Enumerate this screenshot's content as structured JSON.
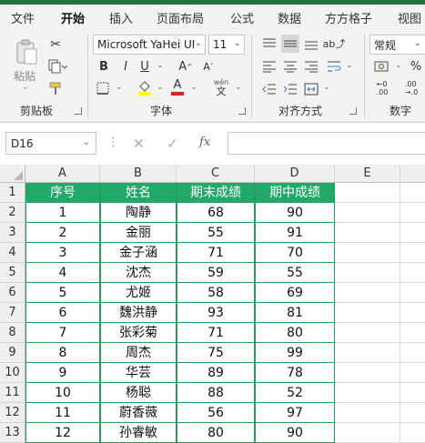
{
  "colors": {
    "accent": "#217346",
    "header_fill": "#22a868",
    "header_text": "#ffffff"
  },
  "tabs": [
    "文件",
    "开始",
    "插入",
    "页面布局",
    "公式",
    "数据",
    "方方格子",
    "视图"
  ],
  "active_tab": "开始",
  "ribbon": {
    "clipboard": {
      "paste_label": "粘贴",
      "group_label": "剪贴板"
    },
    "font": {
      "font_name": "Microsoft YaHei UI",
      "font_size": "11",
      "group_label": "字体",
      "bold": "B",
      "italic": "I",
      "underline": "U",
      "grow": "A",
      "shrink": "A",
      "phonetic_top": "wén",
      "phonetic_bottom": "文"
    },
    "alignment": {
      "group_label": "对齐方式"
    },
    "number": {
      "format": "常规",
      "group_label": "数字"
    }
  },
  "formula_bar": {
    "name_box": "D16",
    "cancel": "✕",
    "enter": "✓",
    "fx": "fx",
    "formula": ""
  },
  "sheet": {
    "columns": [
      "A",
      "B",
      "C",
      "D",
      "E"
    ],
    "row_numbers": [
      "1",
      "2",
      "3",
      "4",
      "5",
      "6",
      "7",
      "8",
      "9",
      "10",
      "11",
      "12",
      "13"
    ],
    "headers": [
      "序号",
      "姓名",
      "期末成绩",
      "期中成绩"
    ],
    "rows": [
      [
        "1",
        "陶静",
        "68",
        "90"
      ],
      [
        "2",
        "金丽",
        "55",
        "91"
      ],
      [
        "3",
        "金子涵",
        "71",
        "70"
      ],
      [
        "4",
        "沈杰",
        "59",
        "55"
      ],
      [
        "5",
        "尤姬",
        "58",
        "69"
      ],
      [
        "6",
        "魏洪静",
        "93",
        "81"
      ],
      [
        "7",
        "张彩菊",
        "71",
        "80"
      ],
      [
        "8",
        "周杰",
        "75",
        "99"
      ],
      [
        "9",
        "华芸",
        "89",
        "78"
      ],
      [
        "10",
        "杨聪",
        "88",
        "52"
      ],
      [
        "11",
        "蔚香薇",
        "56",
        "97"
      ],
      [
        "12",
        "孙睿敏",
        "80",
        "90"
      ]
    ]
  }
}
